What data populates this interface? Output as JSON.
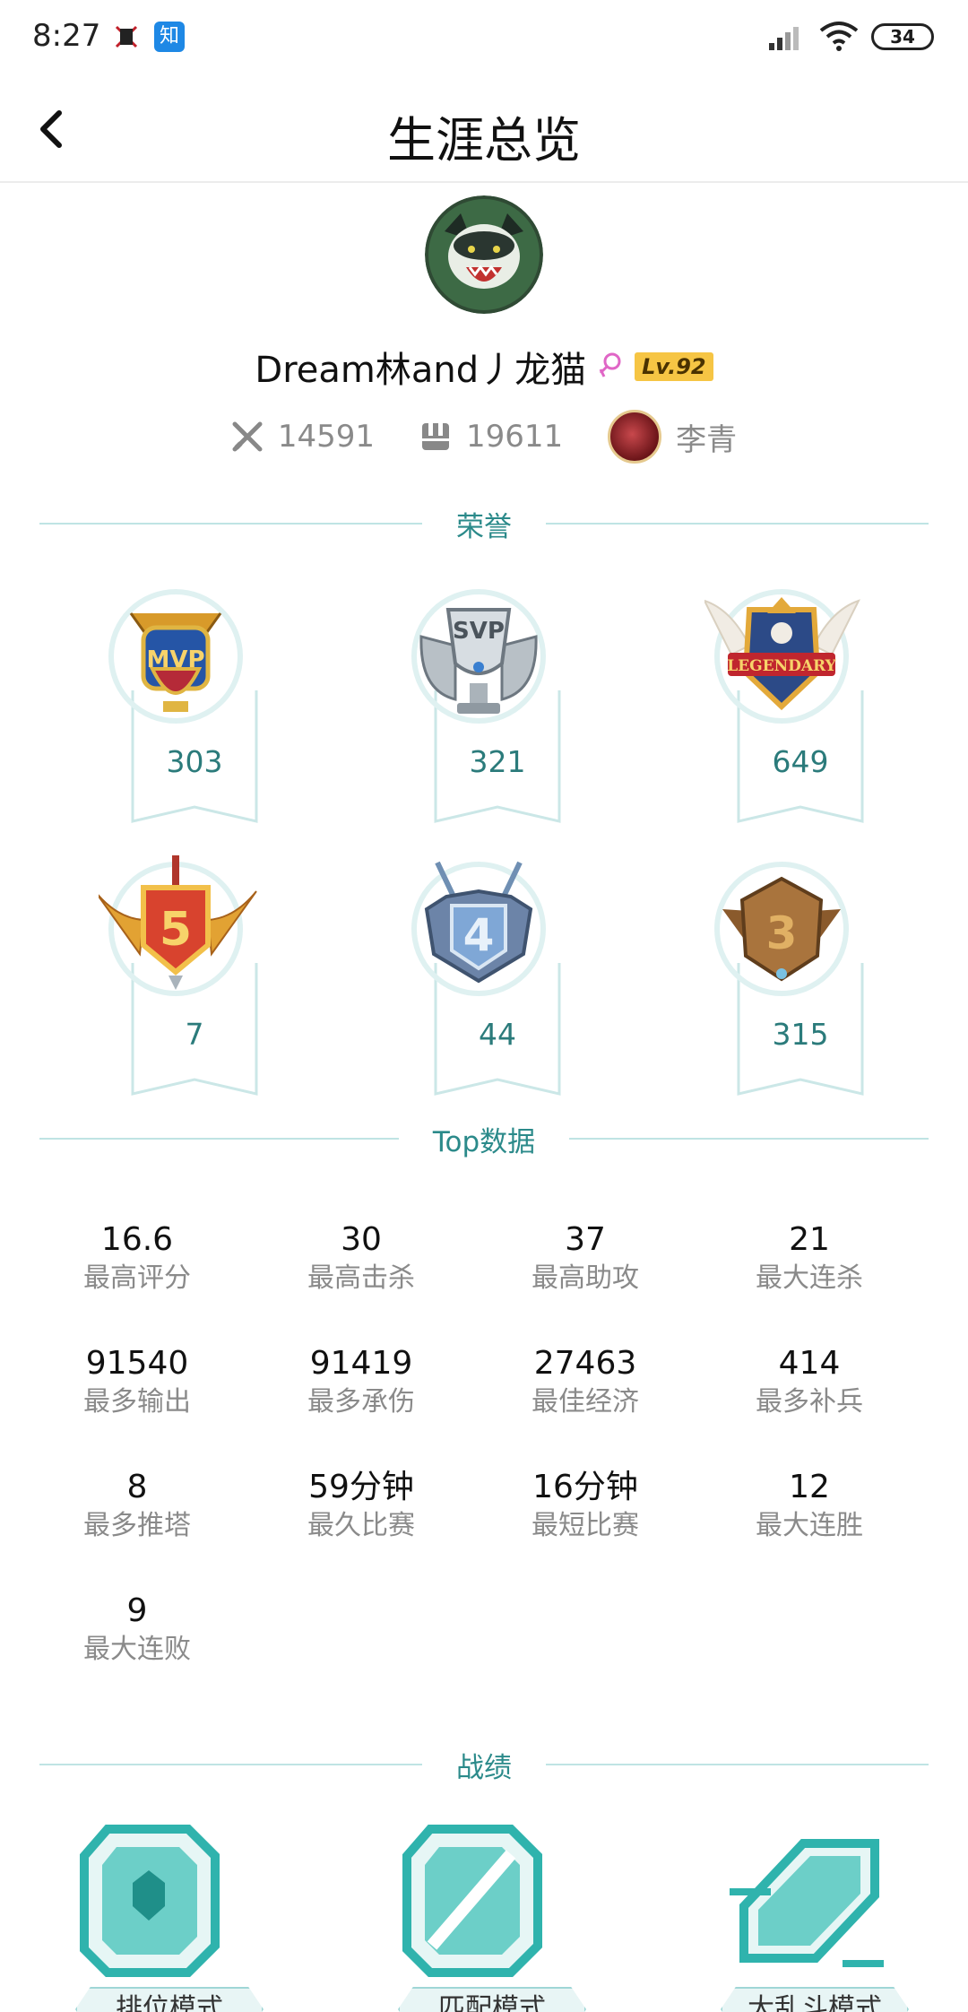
{
  "status_bar": {
    "time": "8:27",
    "app_icon_2_text": "知",
    "battery": "34"
  },
  "header": {
    "title": "生涯总览",
    "back_icon": "chevron-left-icon"
  },
  "profile": {
    "name": "Dream林and丿龙猫",
    "gender_icon": "female-icon",
    "level": "Lv.92",
    "stats": [
      {
        "icon": "swords-icon",
        "value": "14591"
      },
      {
        "icon": "matches-icon",
        "value": "19611"
      },
      {
        "icon": "hero-avatar",
        "value": "李青"
      }
    ]
  },
  "honors": {
    "title": "荣誉",
    "items": [
      {
        "name": "MVP",
        "count": "303"
      },
      {
        "name": "SVP",
        "count": "321"
      },
      {
        "name": "LEGENDARY",
        "count": "649"
      },
      {
        "name": "5",
        "count": "7"
      },
      {
        "name": "4",
        "count": "44"
      },
      {
        "name": "3",
        "count": "315"
      }
    ]
  },
  "top_data": {
    "title": "Top数据",
    "items": [
      {
        "value": "16.6",
        "label": "最高评分"
      },
      {
        "value": "30",
        "label": "最高击杀"
      },
      {
        "value": "37",
        "label": "最高助攻"
      },
      {
        "value": "21",
        "label": "最大连杀"
      },
      {
        "value": "91540",
        "label": "最多输出"
      },
      {
        "value": "91419",
        "label": "最多承伤"
      },
      {
        "value": "27463",
        "label": "最佳经济"
      },
      {
        "value": "414",
        "label": "最多补兵"
      },
      {
        "value": "8",
        "label": "最多推塔"
      },
      {
        "value": "59分钟",
        "label": "最久比赛"
      },
      {
        "value": "16分钟",
        "label": "最短比赛"
      },
      {
        "value": "12",
        "label": "最大连胜"
      },
      {
        "value": "9",
        "label": "最大连败"
      }
    ]
  },
  "records": {
    "title": "战绩",
    "modes": [
      {
        "label": "排位模式"
      },
      {
        "label": "匹配模式"
      },
      {
        "label": "大乱斗模式"
      }
    ]
  },
  "colors": {
    "accent_teal": "#2b8a8a",
    "divider": "#bfe4e4",
    "level_badge": "#f6c544"
  }
}
